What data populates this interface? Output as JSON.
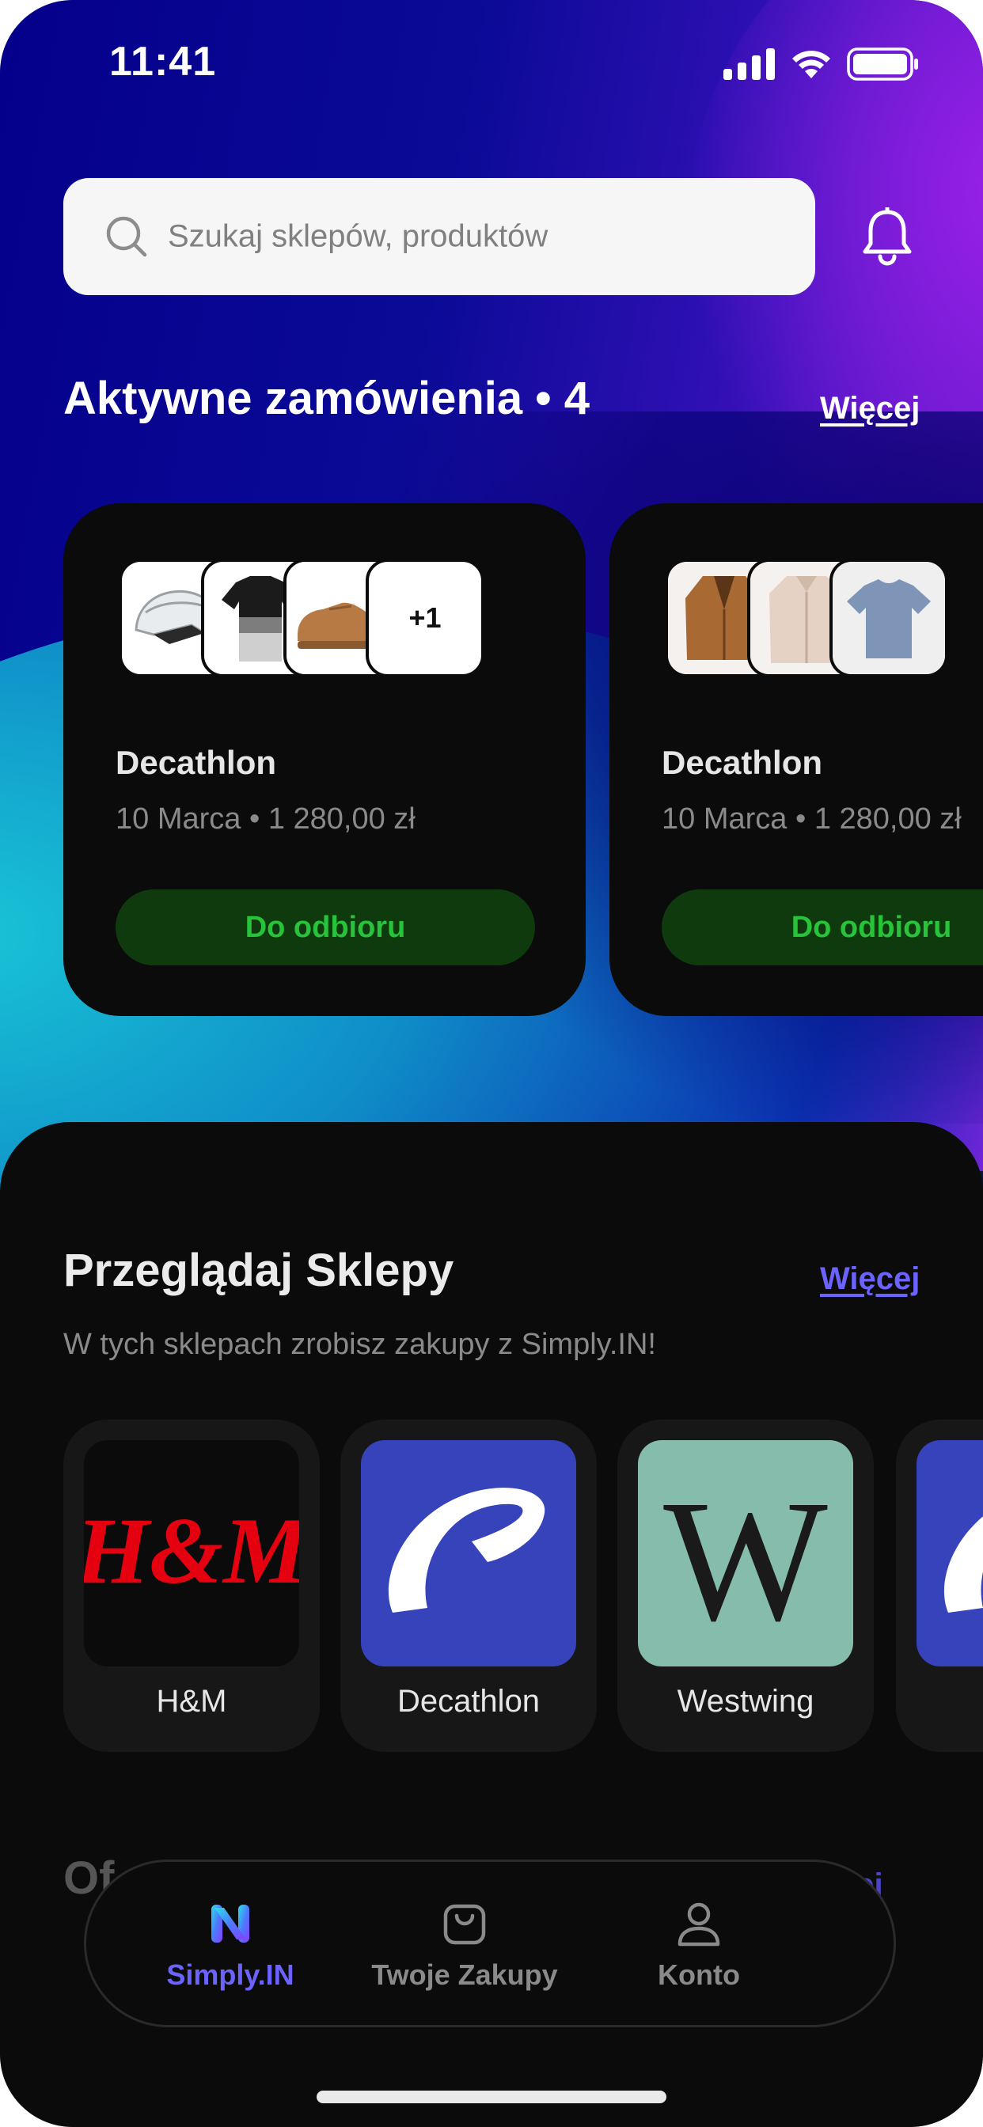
{
  "status_bar": {
    "time": "11:41"
  },
  "search": {
    "placeholder": "Szukaj sklepów, produktów"
  },
  "active_orders": {
    "title": "Aktywne zamówienia • 4",
    "more_label": "Więcej",
    "orders": [
      {
        "store": "Decathlon",
        "meta": "10 Marca • 1 280,00 zł",
        "status": "Do odbioru",
        "extra_items": "+1"
      },
      {
        "store": "Decathlon",
        "meta": "10 Marca • 1 280,00 zł",
        "status": "Do odbioru"
      }
    ]
  },
  "browse": {
    "title": "Przeglądaj Sklepy",
    "more_label": "Więcej",
    "subtitle": "W tych sklepach zrobisz zakupy z Simply.IN!",
    "shops": [
      {
        "name": "H&M",
        "logo_text": "H&M"
      },
      {
        "name": "Decathlon"
      },
      {
        "name": "Westwing",
        "logo_text": "W"
      }
    ]
  },
  "offers": {
    "title": "Of",
    "more_label": "cej"
  },
  "nav": {
    "items": [
      {
        "label": "Simply.IN",
        "icon": "simplyin-logo-icon",
        "active": true
      },
      {
        "label": "Twoje Zakupy",
        "icon": "shopping-bag-icon"
      },
      {
        "label": "Konto",
        "icon": "user-icon"
      }
    ]
  },
  "colors": {
    "accent": "#6b63ff",
    "status_green": "#27c33a",
    "status_green_bg": "#0f3a0d",
    "hm_red": "#e50010",
    "decathlon_blue": "#3643ba",
    "westwing_green": "#86bcac"
  }
}
